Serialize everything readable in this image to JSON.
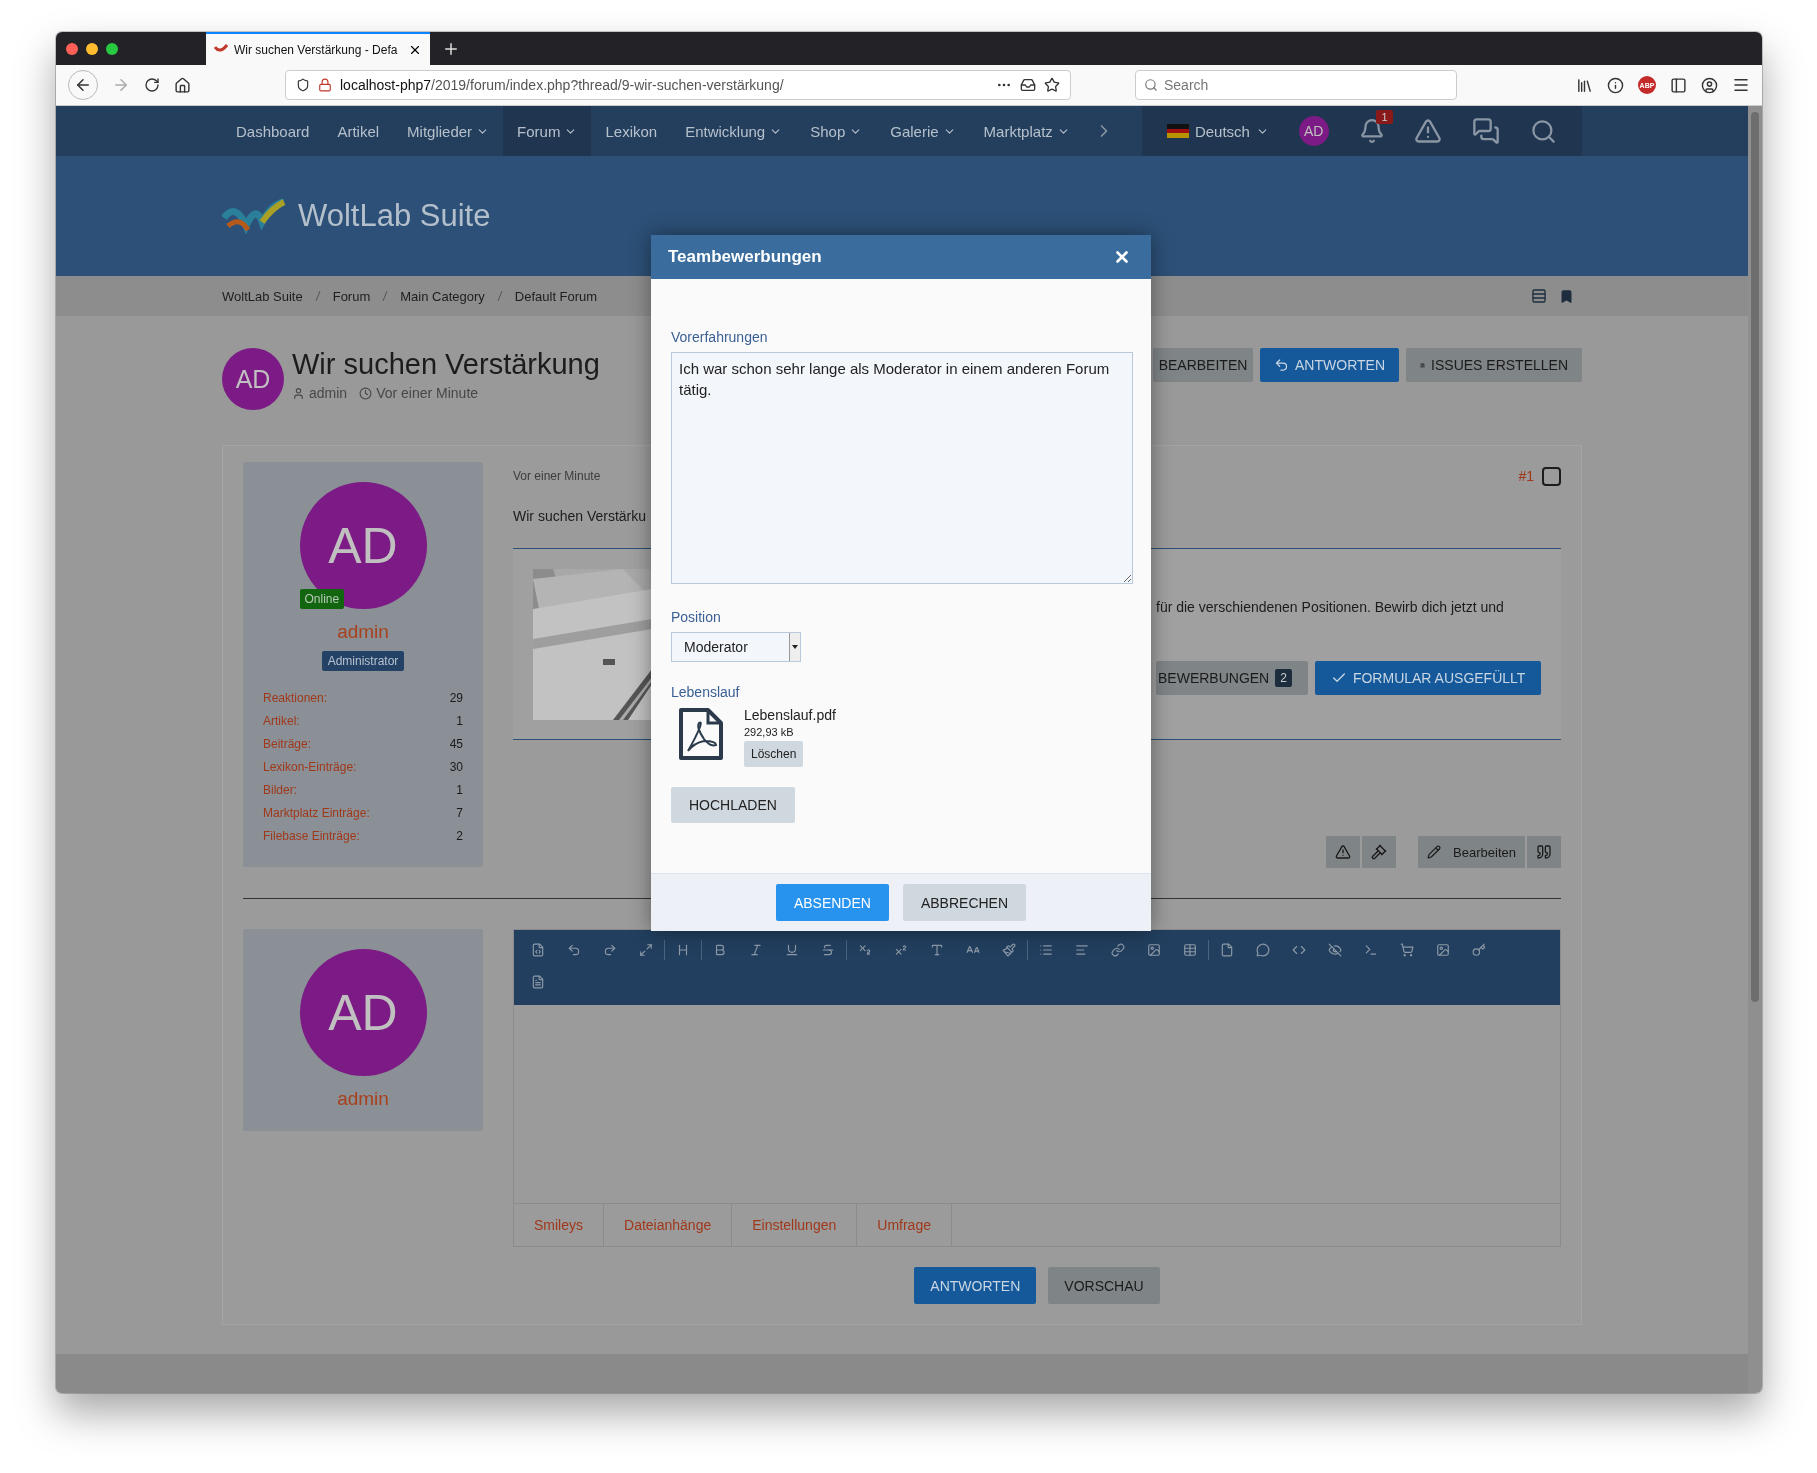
{
  "browser": {
    "tab_title": "Wir suchen Verstärkung - Defa",
    "url_host": "localhost-php7",
    "url_path": "/2019/forum/index.php?thread/9-wir-suchen-verstärkung/",
    "search_placeholder": "Search",
    "adblock_label": "ABP"
  },
  "nav": {
    "items": [
      {
        "label": "Dashboard",
        "dropdown": false,
        "selected": false
      },
      {
        "label": "Artikel",
        "dropdown": false,
        "selected": false
      },
      {
        "label": "Mitglieder",
        "dropdown": true,
        "selected": false
      },
      {
        "label": "Forum",
        "dropdown": true,
        "selected": true
      },
      {
        "label": "Lexikon",
        "dropdown": false,
        "selected": false
      },
      {
        "label": "Entwicklung",
        "dropdown": true,
        "selected": false
      },
      {
        "label": "Shop",
        "dropdown": true,
        "selected": false
      },
      {
        "label": "Galerie",
        "dropdown": true,
        "selected": false
      },
      {
        "label": "Marktplatz",
        "dropdown": true,
        "selected": false
      }
    ],
    "language": "Deutsch",
    "avatar": "AD",
    "notification_count": "1"
  },
  "logo": "WoltLab Suite",
  "breadcrumbs": [
    "WoltLab Suite",
    "Forum",
    "Main Category",
    "Default Forum"
  ],
  "thread": {
    "avatar": "AD",
    "title": "Wir suchen Verstärkung",
    "author": "admin",
    "time": "Vor einer Minute",
    "buttons": [
      {
        "label": "BEARBEITEN",
        "kind": "plain"
      },
      {
        "label": "ANTWORTEN",
        "kind": "reply"
      },
      {
        "label": "ISSUES ERSTELLEN",
        "kind": "bug"
      }
    ]
  },
  "post": {
    "user": {
      "avatar": "AD",
      "status": "Online",
      "name": "admin",
      "rank": "Administrator",
      "stats": [
        {
          "label": "Reaktionen:",
          "value": "29"
        },
        {
          "label": "Artikel:",
          "value": "1"
        },
        {
          "label": "Beiträge:",
          "value": "45"
        },
        {
          "label": "Lexikon-Einträge:",
          "value": "30"
        },
        {
          "label": "Bilder:",
          "value": "1"
        },
        {
          "label": "Marktplatz Einträge:",
          "value": "7"
        },
        {
          "label": "Filebase Einträge:",
          "value": "2"
        }
      ]
    },
    "time": "Vor einer Minute",
    "number": "#1",
    "checked": false,
    "title": "Wir suchen Verstärku",
    "text": "für die verschiendenen Positionen. Bewirb dich jetzt und",
    "buttons": [
      {
        "label": "BEWERBUNGEN",
        "count": "2",
        "kind": "plain"
      },
      {
        "label": "FORMULAR AUSGEFÜLLT",
        "kind": "check"
      }
    ],
    "actions": [
      {
        "kind": "warning"
      },
      {
        "kind": "hammer"
      },
      {
        "kind": "edit",
        "label": "Bearbeiten"
      },
      {
        "kind": "quote"
      }
    ]
  },
  "reply": {
    "user": {
      "avatar": "AD",
      "name": "admin"
    },
    "tabs": [
      "Smileys",
      "Dateianhänge",
      "Einstellungen",
      "Umfrage"
    ],
    "buttons": [
      {
        "label": "ANTWORTEN",
        "kind": "primary"
      },
      {
        "label": "VORSCHAU",
        "kind": "secondary"
      }
    ]
  },
  "dialog": {
    "title": "Teambewerbungen",
    "fields": [
      {
        "kind": "textarea",
        "label": "Vorerfahrungen",
        "value": "Ich war schon sehr lange als Moderator in einem anderen Forum tätig."
      },
      {
        "kind": "select",
        "label": "Position",
        "value": "Moderator"
      },
      {
        "kind": "upload",
        "label": "Lebenslauf",
        "file_name": "Lebenslauf.pdf",
        "file_size": "292,93 kB",
        "delete_label": "Löschen",
        "upload_label": "HOCHLADEN"
      }
    ],
    "buttons": [
      {
        "label": "ABSENDEN",
        "kind": "primary"
      },
      {
        "label": "ABBRECHEN",
        "kind": "secondary"
      }
    ]
  }
}
